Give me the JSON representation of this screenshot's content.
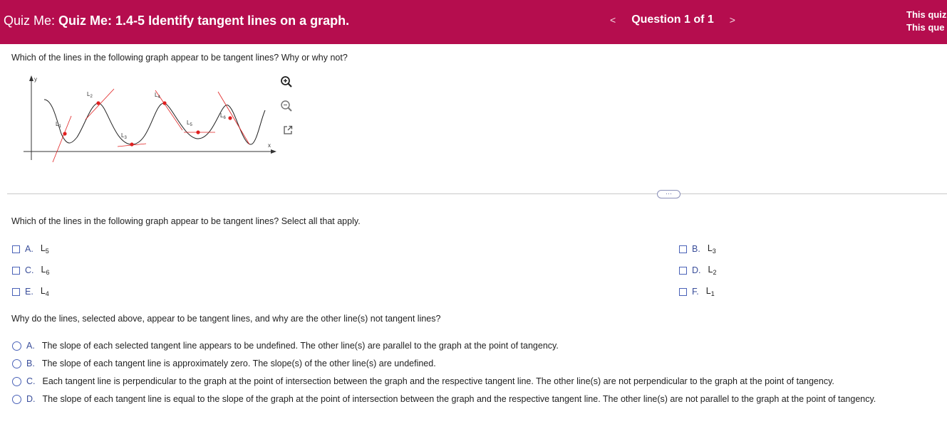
{
  "header": {
    "prefix": "Quiz Me:",
    "title": "Quiz Me: 1.4-5 Identify tangent lines on a graph.",
    "prev_arrow": "<",
    "question_label": "Question 1 of 1",
    "next_arrow": ">",
    "info_line1": "This quiz",
    "info_line2": "This que"
  },
  "graph": {
    "y_axis_label": "y",
    "x_axis_label": "x",
    "line_labels": [
      {
        "base": "L",
        "sub": "1"
      },
      {
        "base": "L",
        "sub": "2"
      },
      {
        "base": "L",
        "sub": "3"
      },
      {
        "base": "L",
        "sub": "4"
      },
      {
        "base": "L",
        "sub": "5"
      },
      {
        "base": "L",
        "sub": "6"
      }
    ],
    "accent_color": "#e02020",
    "tools": [
      "zoom-in-icon",
      "zoom-out-icon",
      "expand-icon"
    ]
  },
  "question": {
    "intro": "Which of the lines in the following graph appear to be tangent lines? Why or why not?",
    "part1_prompt": "Which of the lines in the following graph appear to be tangent lines? Select all that apply.",
    "part1_options": [
      {
        "letter": "A.",
        "base": "L",
        "sub": "5"
      },
      {
        "letter": "B.",
        "base": "L",
        "sub": "3"
      },
      {
        "letter": "C.",
        "base": "L",
        "sub": "6"
      },
      {
        "letter": "D.",
        "base": "L",
        "sub": "2"
      },
      {
        "letter": "E.",
        "base": "L",
        "sub": "4"
      },
      {
        "letter": "F.",
        "base": "L",
        "sub": "1"
      }
    ],
    "part2_prompt": "Why do the lines, selected above, appear to be tangent lines, and why are the other line(s) not tangent lines?",
    "part2_options": [
      {
        "letter": "A.",
        "text": "The slope of each selected tangent line appears to be undefined. The other line(s) are parallel to the graph at the point of tangency."
      },
      {
        "letter": "B.",
        "text": "The slope of each tangent line is approximately zero. The slope(s) of the other line(s) are undefined."
      },
      {
        "letter": "C.",
        "text": "Each tangent line is perpendicular to the graph at the point of intersection between the graph and the respective tangent line. The other line(s) are not perpendicular to the graph at the point of tangency."
      },
      {
        "letter": "D.",
        "text": "The slope of each tangent line is equal to the slope of the graph at the point of intersection between the graph and the respective tangent line. The other line(s) are not parallel to the graph at the point of tangency."
      }
    ],
    "more_button": "···"
  }
}
